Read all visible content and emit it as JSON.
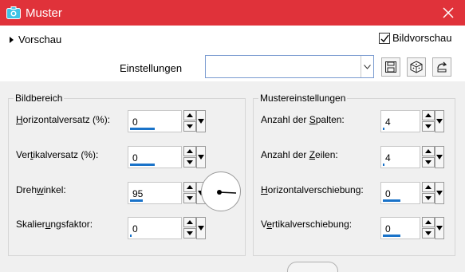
{
  "window": {
    "title": "Muster"
  },
  "preview": {
    "toggle_label": "Vorschau",
    "checkbox_label": "Bildvorschau",
    "checked": true
  },
  "settings": {
    "label": "Einstellungen",
    "value": ""
  },
  "image_area": {
    "title": "Bildbereich",
    "h_offset": {
      "label_pre": "",
      "label_u": "H",
      "label_post": "orizontalversatz (%):",
      "value": "0",
      "fill": 0.5
    },
    "v_offset": {
      "label_pre": "Ver",
      "label_u": "t",
      "label_post": "ikalversatz (%):",
      "value": "0",
      "fill": 0.5
    },
    "angle": {
      "label_pre": "Dreh",
      "label_u": "w",
      "label_post": "inkel:",
      "value": "95",
      "fill": 0.26
    },
    "scale": {
      "label_pre": "Skalier",
      "label_u": "u",
      "label_post": "ngsfaktor:",
      "value": "0",
      "fill": 0.03
    }
  },
  "pattern": {
    "title": "Mustereinstellungen",
    "columns": {
      "label_pre": "Anzahl der ",
      "label_u": "S",
      "label_post": "palten:",
      "value": "4",
      "fill": 0.03
    },
    "rows": {
      "label_pre": "Anzahl der ",
      "label_u": "Z",
      "label_post": "eilen:",
      "value": "4",
      "fill": 0.03
    },
    "h_shift": {
      "label_pre": "",
      "label_u": "H",
      "label_post": "orizontalverschiebung:",
      "value": "0",
      "fill": 0.5
    },
    "v_shift": {
      "label_pre": "V",
      "label_u": "e",
      "label_post": "rtikalverschiebung:",
      "value": "0",
      "fill": 0.5
    }
  }
}
